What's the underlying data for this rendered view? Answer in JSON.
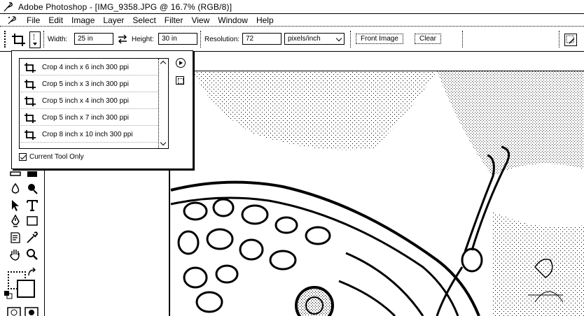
{
  "window": {
    "title": "Adobe Photoshop - [IMG_9358.JPG @ 16.7% (RGB/8)]"
  },
  "menu": [
    "File",
    "Edit",
    "Image",
    "Layer",
    "Select",
    "Filter",
    "View",
    "Window",
    "Help"
  ],
  "options": {
    "width_label": "Width:",
    "width_value": "25 in",
    "height_label": "Height:",
    "height_value": "30 in",
    "resolution_label": "Resolution:",
    "resolution_value": "72",
    "resolution_unit": "pixels/inch",
    "front_image_label": "Front Image",
    "clear_label": "Clear"
  },
  "presets": {
    "items": [
      "Crop 4 inch x 6 inch 300 ppi",
      "Crop 5 inch x 3 inch 300 ppi",
      "Crop 5 inch x 4 inch 300 ppi",
      "Crop 5 inch x 7 inch 300 ppi",
      "Crop 8 inch x 10 inch 300 ppi"
    ],
    "current_tool_only_label": "Current Tool Only",
    "current_tool_only_checked": true
  }
}
